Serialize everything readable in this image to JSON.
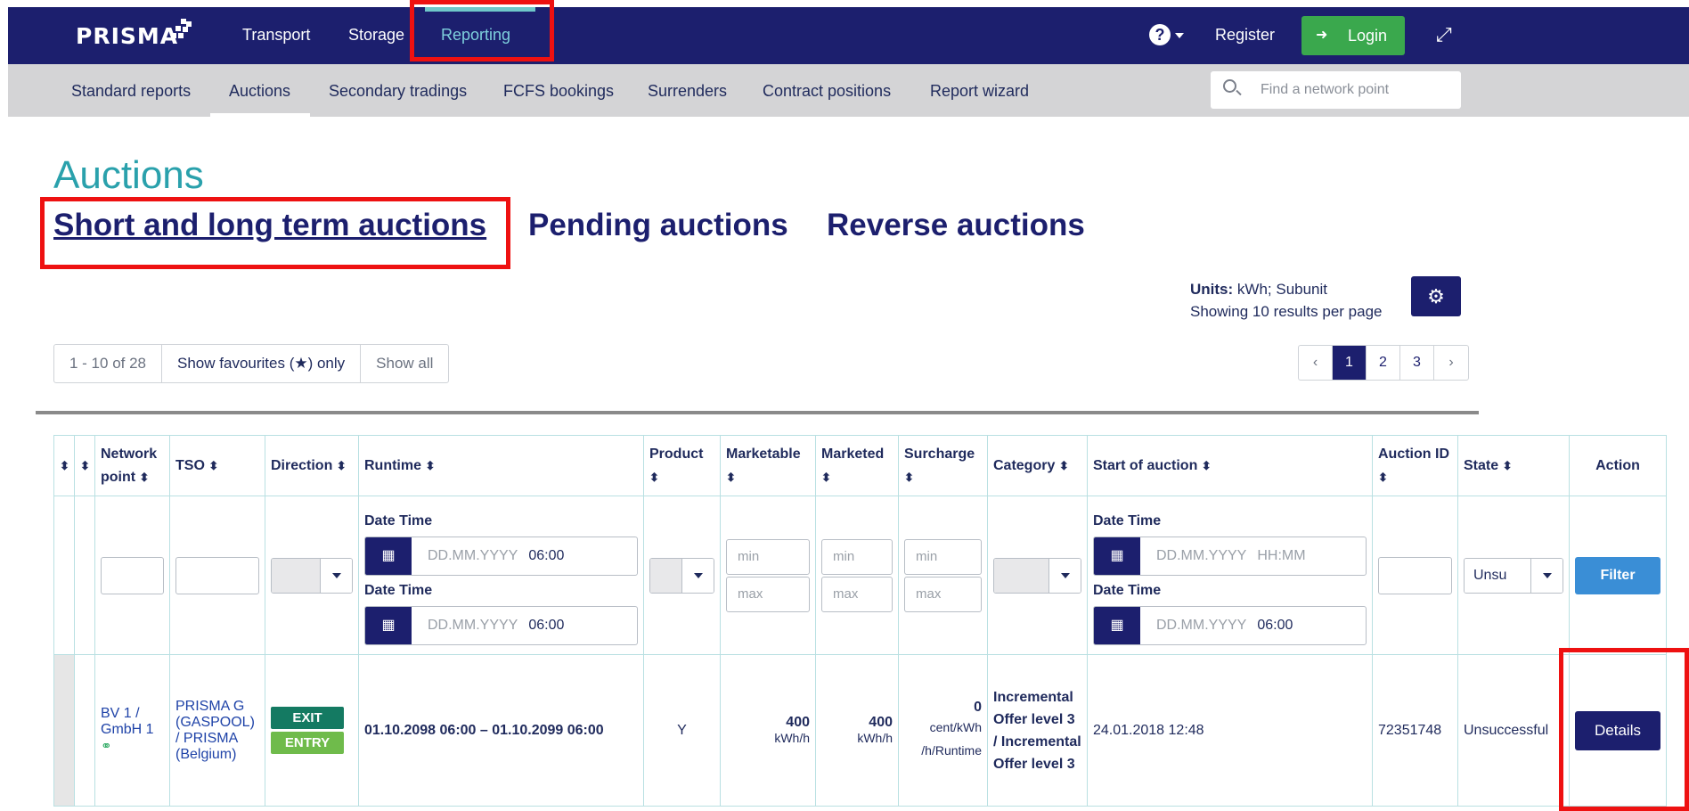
{
  "brand": "PRISMA",
  "topnav": {
    "items": [
      "Transport",
      "Storage",
      "Reporting"
    ],
    "register": "Register",
    "login": "Login"
  },
  "subnav": {
    "items": [
      "Standard reports",
      "Auctions",
      "Secondary tradings",
      "FCFS bookings",
      "Surrenders",
      "Contract positions",
      "Report wizard"
    ],
    "search_placeholder": "Find a network point"
  },
  "page": {
    "title": "Auctions",
    "tabs": [
      "Short and long term auctions",
      "Pending auctions",
      "Reverse auctions"
    ],
    "units_label": "Units:",
    "units_value": "kWh; Subunit",
    "per_page": "Showing 10 results per page"
  },
  "toolbar": {
    "count": "1 - 10 of 28",
    "favourites": "Show favourites (★) only",
    "show_all": "Show all"
  },
  "pager": {
    "prev": "‹",
    "pages": [
      "1",
      "2",
      "3"
    ],
    "next": "›",
    "current": "1"
  },
  "table": {
    "headers": {
      "network_point": "Network point",
      "tso": "TSO",
      "direction": "Direction",
      "runtime": "Runtime",
      "product": "Product",
      "marketable": "Marketable",
      "marketed": "Marketed",
      "surcharge": "Surcharge",
      "category": "Category",
      "start": "Start of auction",
      "auction_id": "Auction ID",
      "state": "State",
      "action": "Action"
    },
    "filters": {
      "date_time_label": "Date Time",
      "date_placeholder": "DD.MM.YYYY",
      "runtime_from_time": "06:00",
      "runtime_to_time": "06:00",
      "start_from_time": "HH:MM",
      "start_to_time": "06:00",
      "min": "min",
      "max": "max",
      "state_value": "Unsu",
      "filter_button": "Filter"
    },
    "rows": [
      {
        "network_point": "BV 1 / GmbH 1",
        "tso": "PRISMA G (GASPOOL) / PRISMA (Belgium)",
        "direction_1": "EXIT",
        "direction_2": "ENTRY",
        "runtime": "01.10.2098 06:00 – 01.10.2099 06:00",
        "product": "Y",
        "marketable": "400",
        "marketable_unit": "kWh/h",
        "marketed": "400",
        "marketed_unit": "kWh/h",
        "surcharge": "0",
        "surcharge_unit": "cent/kWh /h/Runtime",
        "category": "Incremental Offer level 3 / Incremental Offer level 3",
        "start": "24.01.2018 12:48",
        "auction_id": "72351748",
        "state": "Unsuccessful",
        "action": "Details"
      }
    ]
  },
  "colors": {
    "navbar": "#1c1f6e",
    "subnav": "#d4d4d6",
    "accent_teal": "#2aa1ac",
    "login_green": "#3aa84d",
    "filter_blue": "#3a8ed6",
    "exit_badge": "#147a62",
    "entry_badge": "#6fbb4b",
    "highlight_red": "#ee1111"
  },
  "icons": [
    "prisma-logo-icon",
    "help-icon",
    "login-icon",
    "expand-icon",
    "search-icon",
    "gear-icon",
    "calendar-icon",
    "sort-icon",
    "link-icon",
    "chevron-down-icon"
  ]
}
